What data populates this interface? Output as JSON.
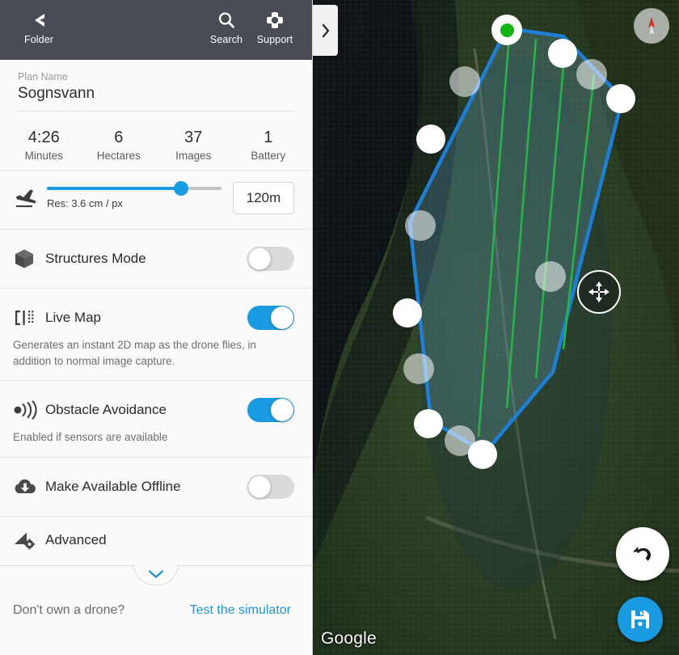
{
  "header": {
    "back_label": "Folder",
    "search_label": "Search",
    "support_label": "Support",
    "background": "#474c55"
  },
  "plan": {
    "label": "Plan Name",
    "value": "Sognsvann"
  },
  "stats": [
    {
      "value": "4:26",
      "caption": "Minutes"
    },
    {
      "value": "6",
      "caption": "Hectares"
    },
    {
      "value": "37",
      "caption": "Images"
    },
    {
      "value": "1",
      "caption": "Battery"
    }
  ],
  "altitude": {
    "resolution_text": "Res: 3.6 cm / px",
    "value": "120m",
    "slider_percent": 77,
    "accent": "#1a9ae0"
  },
  "options": [
    {
      "title": "Structures Mode",
      "subtitle": "",
      "toggle": "off",
      "icon": "cube-icon"
    },
    {
      "title": "Live Map",
      "subtitle": "Generates an instant 2D map as the drone flies, in addition to normal image capture.",
      "toggle": "on",
      "icon": "live-map-icon"
    },
    {
      "title": "Obstacle Avoidance",
      "subtitle": "Enabled if sensors are available",
      "toggle": "on",
      "icon": "sensor-waves-icon"
    },
    {
      "title": "Make Available Offline",
      "subtitle": "",
      "toggle": "off",
      "icon": "cloud-download-icon"
    }
  ],
  "advanced": {
    "title": "Advanced",
    "icon": "wing-gear-icon"
  },
  "footer": {
    "question": "Don't own a drone?",
    "link": "Test the simulator",
    "link_color": "#2196d4"
  },
  "map": {
    "attribution": "Google",
    "start_label": "start",
    "polygon_color": "#1e7fd4",
    "path_color": "#28b24a",
    "fill_color": "rgba(120,190,225,0.22)",
    "compass_needle_color": "#d32f2f",
    "save_color": "#1a9ae0",
    "icons": {
      "side_tab": "chevron-right-icon",
      "compass": "compass-icon",
      "move": "move-handle-icon",
      "undo": "undo-icon",
      "save": "save-floppy-icon"
    }
  }
}
